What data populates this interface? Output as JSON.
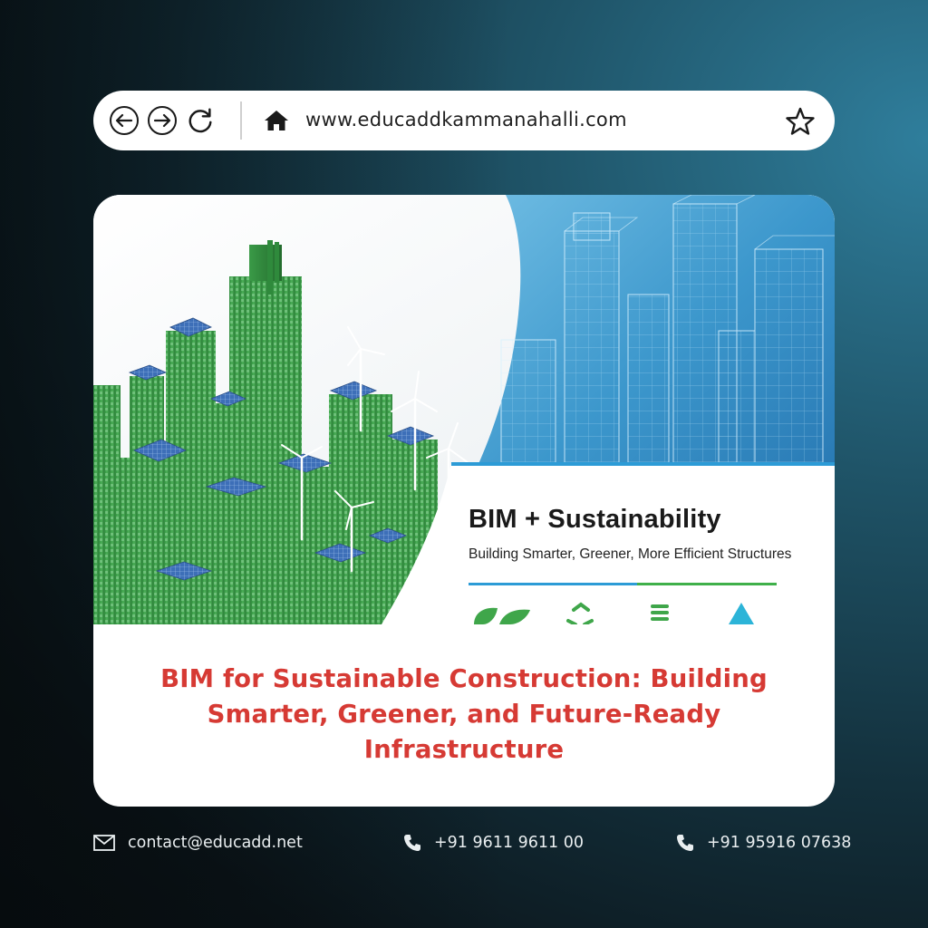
{
  "browser": {
    "url": "www.educaddkammanahalli.com",
    "icons": [
      "arrow-left-icon",
      "arrow-right-icon",
      "reload-icon",
      "home-icon",
      "star-icon"
    ]
  },
  "hero": {
    "overlay_title": "BIM + Sustainability",
    "overlay_subtitle": "Building Smarter, Greener, More Efficient Structures"
  },
  "article": {
    "title": "BIM for Sustainable Construction: Building Smarter, Greener, and Future-Ready Infrastructure"
  },
  "footer": {
    "email": "contact@educadd.net",
    "phone_1": "+91 9611 9611 00",
    "phone_2": "+91 95916 07638"
  },
  "colors": {
    "title_red": "#d63a34",
    "building_green": "#3f9a4a",
    "accent_blue": "#2c9bd6",
    "accent_green": "#3fb04a"
  }
}
